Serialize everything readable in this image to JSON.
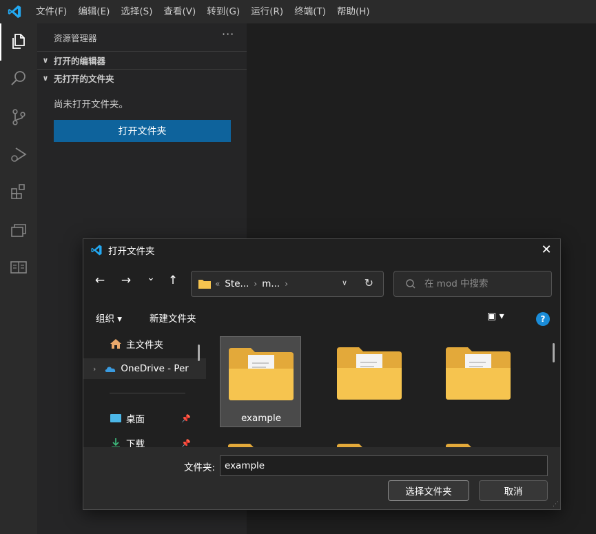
{
  "menubar": {
    "items": [
      "文件(F)",
      "编辑(E)",
      "选择(S)",
      "查看(V)",
      "转到(G)",
      "运行(R)",
      "终端(T)",
      "帮助(H)"
    ]
  },
  "activity_bar": {
    "icons": [
      "explorer-icon",
      "search-icon",
      "source-control-icon",
      "run-debug-icon",
      "extensions-icon",
      "remote-explorer-icon",
      "reader-icon"
    ]
  },
  "sidebar": {
    "title": "资源管理器",
    "more": "···",
    "open_editors": "打开的编辑器",
    "no_folder_section": "无打开的文件夹",
    "no_folder_text": "尚未打开文件夹。",
    "open_folder_button": "打开文件夹"
  },
  "dialog": {
    "title": "打开文件夹",
    "close": "✕",
    "nav": {
      "back": "←",
      "forward": "→",
      "recent": "⌄",
      "up": "↑"
    },
    "address": {
      "overflow": "«",
      "segments": [
        "Ste...",
        "m..."
      ],
      "sep": "›"
    },
    "search_placeholder": "在 mod 中搜索",
    "toolbar": {
      "organize": "组织 ▾",
      "new_folder": "新建文件夹",
      "view": "▣ ▾",
      "help": "?"
    },
    "nav_pane": {
      "home": "主文件夹",
      "onedrive": "OneDrive - Per",
      "desktop": "桌面",
      "downloads": "下载"
    },
    "folders": [
      {
        "label": "example",
        "selected": true
      },
      {
        "label": "",
        "selected": false
      },
      {
        "label": "",
        "selected": false
      }
    ],
    "bottom": {
      "folder_label": "文件夹:",
      "folder_value": "example",
      "select_button": "选择文件夹",
      "cancel_button": "取消"
    }
  },
  "colors": {
    "accent_button": "#0e639c",
    "folder_yellow": "#f6c44f",
    "help_blue": "#1a8cd8"
  }
}
